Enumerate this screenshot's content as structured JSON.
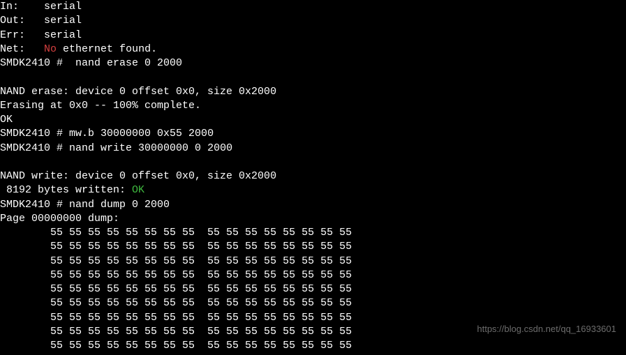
{
  "boot": {
    "in_label": "In:",
    "in_value": "serial",
    "out_label": "Out:",
    "out_value": "serial",
    "err_label": "Err:",
    "err_value": "serial",
    "net_label": "Net:",
    "net_error": "No",
    "net_rest": " ethernet found."
  },
  "prompt": "SMDK2410 # ",
  "cmd": {
    "erase": " nand erase 0 2000",
    "mw": "mw.b 30000000 0x55 2000",
    "write": "nand write 30000000 0 2000",
    "dump": "nand dump 0 2000"
  },
  "erase_out": {
    "line1": "NAND erase: device 0 offset 0x0, size 0x2000",
    "line2": "Erasing at 0x0 -- 100% complete.",
    "line3": "OK"
  },
  "write_out": {
    "line1": "NAND write: device 0 offset 0x0, size 0x2000",
    "line2_prefix": " 8192 bytes written: ",
    "line2_status": "OK"
  },
  "dump_out": {
    "header": "Page 00000000 dump:",
    "row": "        55 55 55 55 55 55 55 55  55 55 55 55 55 55 55 55",
    "row_count": 9
  },
  "watermark": "https://blog.csdn.net/qq_16933601"
}
